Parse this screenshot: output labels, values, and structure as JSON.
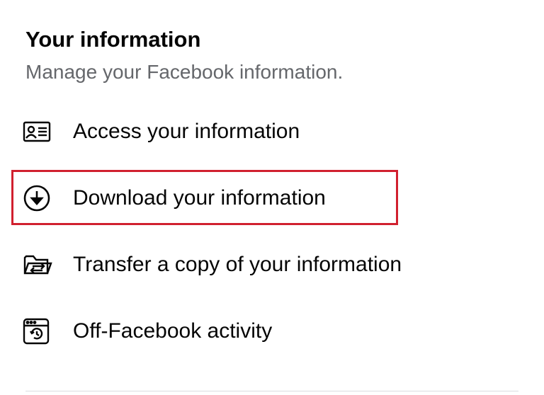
{
  "section": {
    "title": "Your information",
    "subtitle": "Manage your Facebook information."
  },
  "items": [
    {
      "label": "Access your information",
      "icon": "id-card-icon"
    },
    {
      "label": "Download your information",
      "icon": "download-circle-icon"
    },
    {
      "label": "Transfer a copy of your information",
      "icon": "folder-transfer-icon"
    },
    {
      "label": "Off-Facebook activity",
      "icon": "browser-history-icon"
    }
  ],
  "colors": {
    "text": "#050505",
    "secondary_text": "#65676b",
    "highlight": "#d1202f",
    "divider": "#dadde1"
  }
}
